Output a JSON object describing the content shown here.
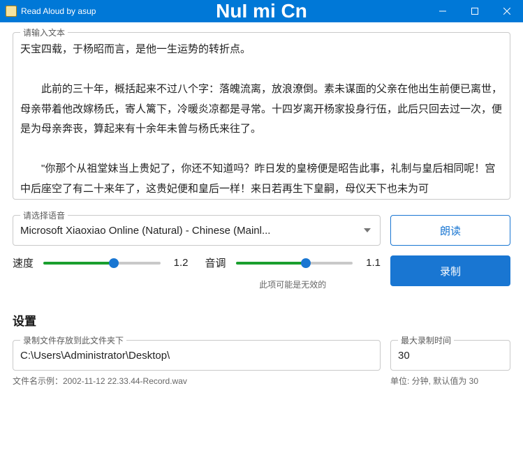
{
  "window": {
    "title": "Read Aloud by asup",
    "watermark": "NuI mi Cn"
  },
  "text_input": {
    "legend": "请输入文本",
    "value": "天宝四载，于杨昭而言，是他一生运势的转折点。\n\n　　此前的三十年，概括起来不过八个字：落魄流离，放浪潦倒。素未谋面的父亲在他出生前便已离世，母亲带着他改嫁杨氏，寄人篱下，冷暖炎凉都是寻常。十四岁离开杨家投身行伍，此后只回去过一次，便是为母亲奔丧，算起来有十余年未曾与杨氏来往了。\n\n　　\"你那个从祖堂妹当上贵妃了，你还不知道吗？昨日发的皇榜便是昭告此事，礼制与皇后相同呢！宫中后座空了有二十来年了，这贵妃便和皇后一样！来日若再生下皇嗣，母仪天下也未为可"
  },
  "voice": {
    "legend": "请选择语音",
    "selected": "Microsoft Xiaoxiao Online (Natural) - Chinese (Mainl..."
  },
  "buttons": {
    "read_label": "朗读",
    "record_label": "录制"
  },
  "sliders": {
    "speed": {
      "label": "速度",
      "value": "1.2"
    },
    "pitch": {
      "label": "音调",
      "value": "1.1",
      "note": "此项可能是无效的"
    }
  },
  "settings": {
    "heading": "设置",
    "save_path": {
      "legend": "录制文件存放到此文件夹下",
      "value": "C:\\Users\\Administrator\\Desktop\\",
      "helper": "文件名示例：2002-11-12 22.33.44-Record.wav"
    },
    "max_time": {
      "legend": "最大录制时间",
      "value": "30",
      "helper": "单位: 分钟, 默认值为 30"
    }
  }
}
